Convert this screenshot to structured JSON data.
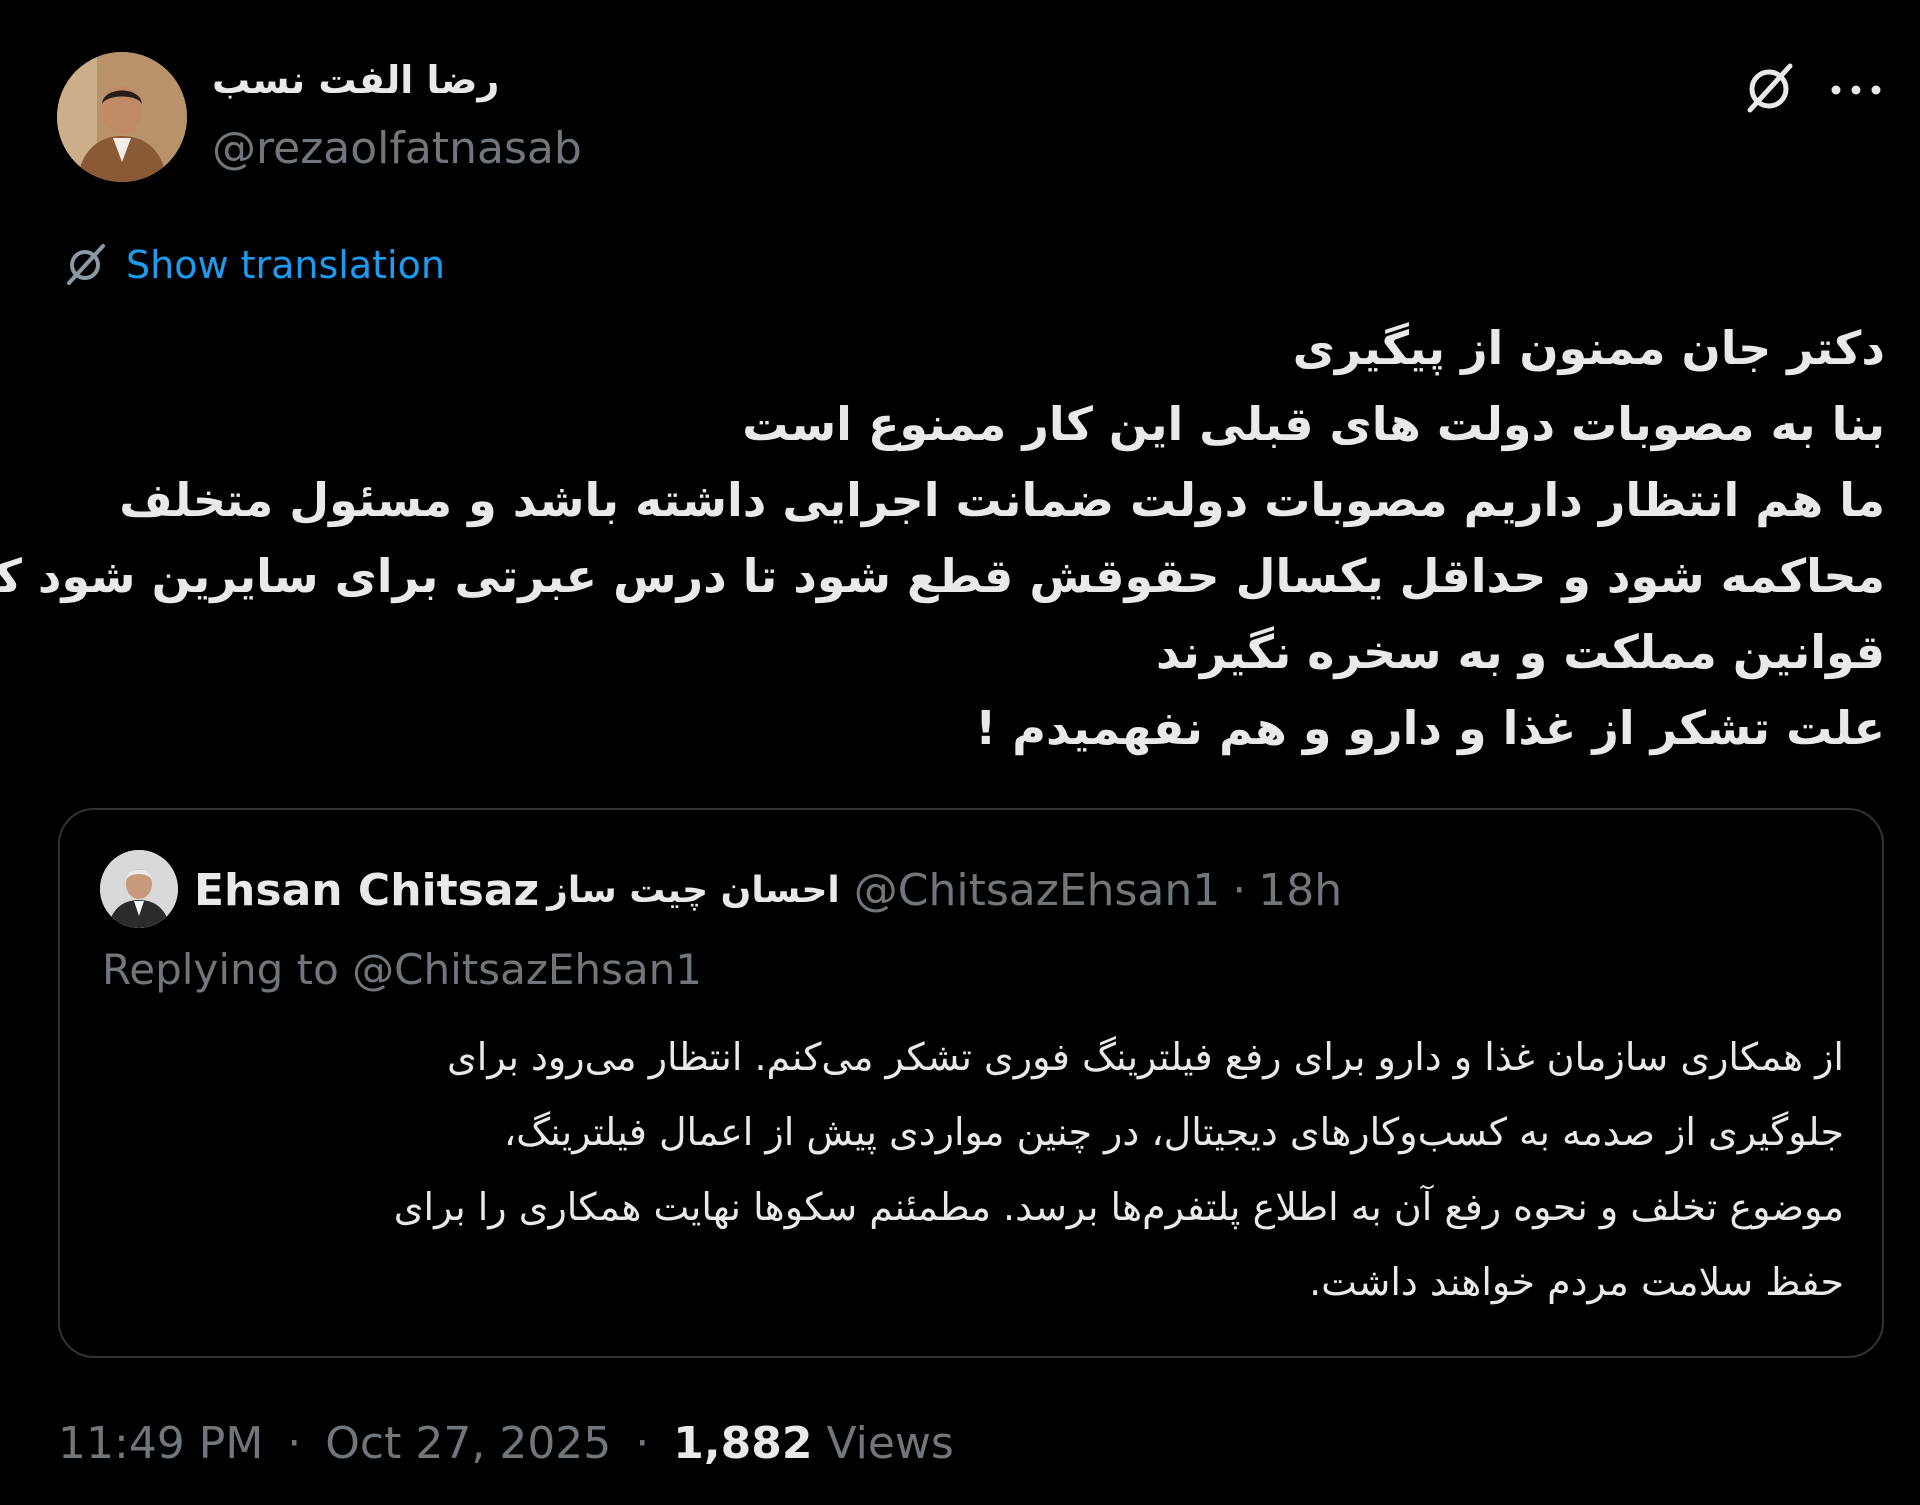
{
  "author": {
    "display_name": "رضا الفت نسب",
    "handle": "@rezaolfatnasab"
  },
  "actions": {
    "grok_icon": "grok-icon",
    "more_icon": "more-icon"
  },
  "translation": {
    "label": "Show translation"
  },
  "tweet": {
    "lines": [
      "دکتر جان ممنون از پیگیری",
      "بنا به مصوبات دولت های قبلی این کار ممنوع است",
      "ما هم انتظار داریم مصوبات دولت ضمانت اجرایی داشته باشد و مسئول متخلف",
      "محاکمه شود و حداقل یکسال حقوقش قطع شود تا درس عبرتی برای سایرین شود که",
      "قوانین مملکت و به سخره نگیرند",
      "علت تشکر از غذا و دارو و هم نفهمیدم !"
    ]
  },
  "quote": {
    "display_name": "Ehsan Chitsaz",
    "display_name_fa": "احسان چیت ساز",
    "handle": "@ChitsazEhsan1",
    "separator": "·",
    "time": "18h",
    "replying_to": "Replying to @ChitsazEhsan1",
    "lines": [
      "از همکاری سازمان غذا و دارو برای رفع فیلترینگ فوری تشکر می‌کنم. انتظار می‌رود برای",
      "جلوگیری از صدمه به کسب‌وکارهای دیجیتال، در چنین مواردی پیش از اعمال فیلترینگ،",
      "موضوع تخلف و نحوه رفع آن به اطلاع پلتفرم‌ها برسد. مطمئنم سکوها نهایت همکاری را برای",
      "حفظ سلامت مردم خواهند داشت."
    ]
  },
  "footer": {
    "time": "11:49 PM",
    "sep1": "·",
    "date": "Oct 27, 2025",
    "sep2": "·",
    "views_count": "1,882",
    "views_label": "Views"
  },
  "colors": {
    "background": "#000000",
    "text": "#e7e9ea",
    "muted": "#71767b",
    "link": "#1d9bf0",
    "border": "#2f3336"
  }
}
